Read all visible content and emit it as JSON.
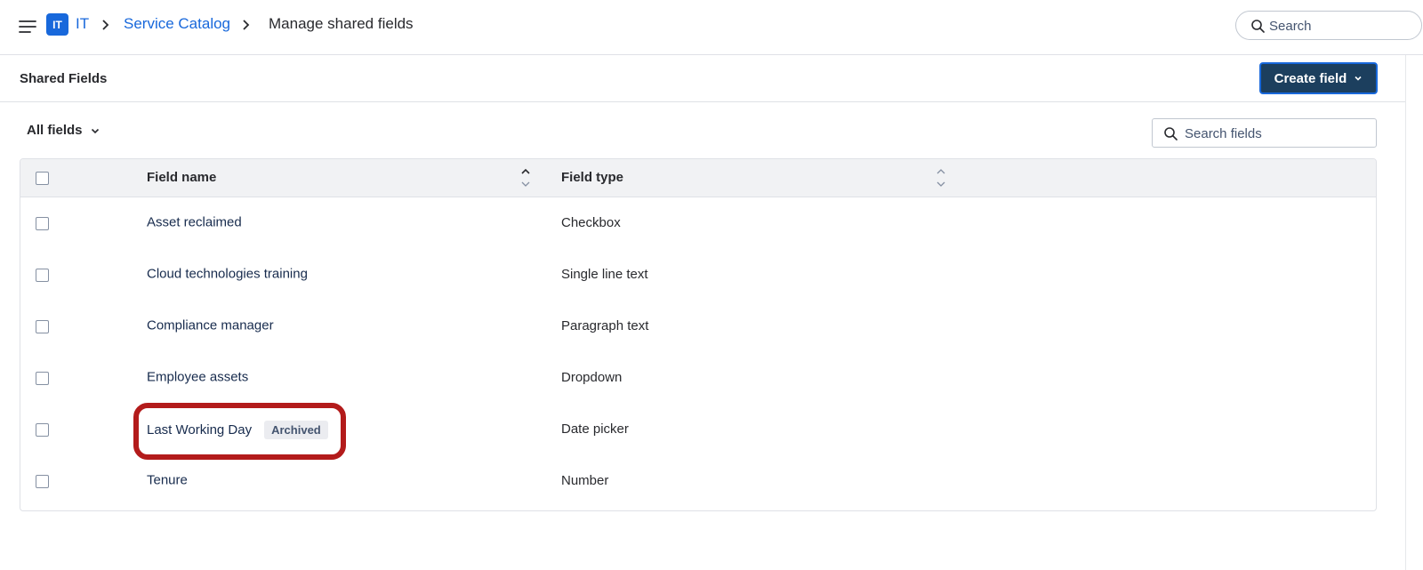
{
  "nav": {
    "project_badge": "IT",
    "breadcrumbs": [
      "IT",
      "Service Catalog",
      "Manage shared fields"
    ],
    "search_placeholder": "Search"
  },
  "page": {
    "title": "Shared Fields",
    "create_button_label": "Create field"
  },
  "filter": {
    "label": "All fields",
    "search_placeholder": "Search fields"
  },
  "table": {
    "columns": [
      "Field name",
      "Field type"
    ],
    "rows": [
      {
        "name": "Asset reclaimed",
        "type": "Checkbox",
        "badge": ""
      },
      {
        "name": "Cloud technologies training",
        "type": "Single line text",
        "badge": ""
      },
      {
        "name": "Compliance manager",
        "type": "Paragraph text",
        "badge": ""
      },
      {
        "name": "Employee assets",
        "type": "Dropdown",
        "badge": ""
      },
      {
        "name": "Last Working Day",
        "type": "Date picker",
        "badge": "Archived"
      },
      {
        "name": "Tenure",
        "type": "Number",
        "badge": ""
      }
    ]
  },
  "colors": {
    "link": "#1868db",
    "primary_button": "#1c3f5e",
    "highlight": "#b31b1b"
  }
}
